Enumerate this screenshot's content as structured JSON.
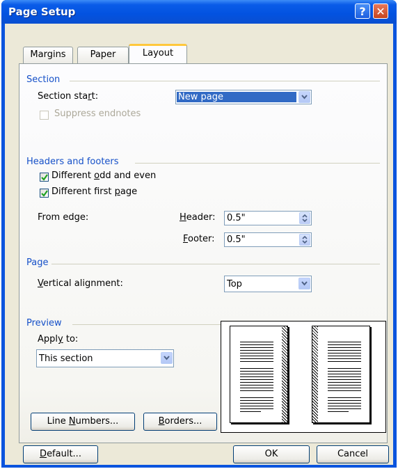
{
  "window": {
    "title": "Page Setup"
  },
  "title_buttons": {
    "help": "?",
    "close": "✕"
  },
  "tabs": [
    {
      "label": "Margins",
      "active": false
    },
    {
      "label": "Paper",
      "active": false
    },
    {
      "label": "Layout",
      "active": true
    }
  ],
  "section": {
    "heading": "Section",
    "start_label_pre": "Section sta",
    "start_label_u": "r",
    "start_label_post": "t:",
    "start_value": "New page",
    "suppress_label": "Suppress endnotes",
    "suppress_checked": false,
    "suppress_enabled": false
  },
  "headers_footers": {
    "heading": "Headers and footers",
    "odd_even_pre": "Different ",
    "odd_even_u": "o",
    "odd_even_post": "dd and even",
    "odd_even_checked": true,
    "first_page_pre": "Different first ",
    "first_page_u": "p",
    "first_page_post": "age",
    "first_page_checked": true,
    "from_edge_label": "From edge:",
    "header_u": "H",
    "header_rest": "eader:",
    "header_value": "0.5\"",
    "footer_u": "F",
    "footer_rest": "ooter:",
    "footer_value": "0.5\""
  },
  "page_group": {
    "heading": "Page",
    "valign_u": "V",
    "valign_rest": "ertical alignment:",
    "valign_value": "Top"
  },
  "preview": {
    "heading": "Preview",
    "apply_pre": "Appl",
    "apply_u": "y",
    "apply_post": " to:",
    "apply_value": "This section"
  },
  "buttons": {
    "line_numbers_pre": "Line ",
    "line_numbers_u": "N",
    "line_numbers_post": "umbers...",
    "borders_u": "B",
    "borders_post": "orders...",
    "default_u": "D",
    "default_post": "efault...",
    "ok": "OK",
    "cancel": "Cancel"
  },
  "colors": {
    "titlebar": "#0a54de",
    "group_heading": "#1550c8",
    "active_tab_accent": "#ffc83c",
    "check": "#21a121"
  }
}
